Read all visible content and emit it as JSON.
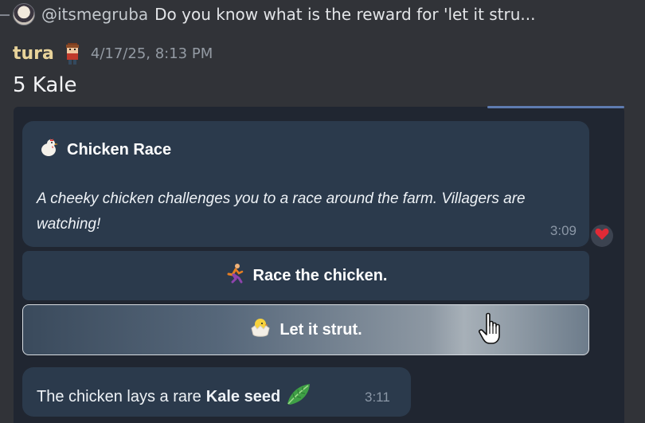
{
  "reply": {
    "handle": "@itsmegruba",
    "preview": "Do you know what is the reward for 'let it stru..."
  },
  "message": {
    "author": "tura",
    "timestamp": "4/17/25, 8:13 PM",
    "text": "5 Kale"
  },
  "embed": {
    "title": "Chicken Race",
    "description": "A cheeky chicken challenges you to a race around the farm. Villagers are watching!",
    "time": "3:09",
    "reaction_icon": "heart-icon"
  },
  "buttons": {
    "race_label": "Race the chicken.",
    "strut_label": "Let it strut."
  },
  "result": {
    "text_prefix": "The chicken lays a rare",
    "text_bold": "Kale seed",
    "time": "3:11"
  },
  "colors": {
    "author": "#e8d39a",
    "bubble": "#2b3a4c",
    "panel": "#202631"
  }
}
